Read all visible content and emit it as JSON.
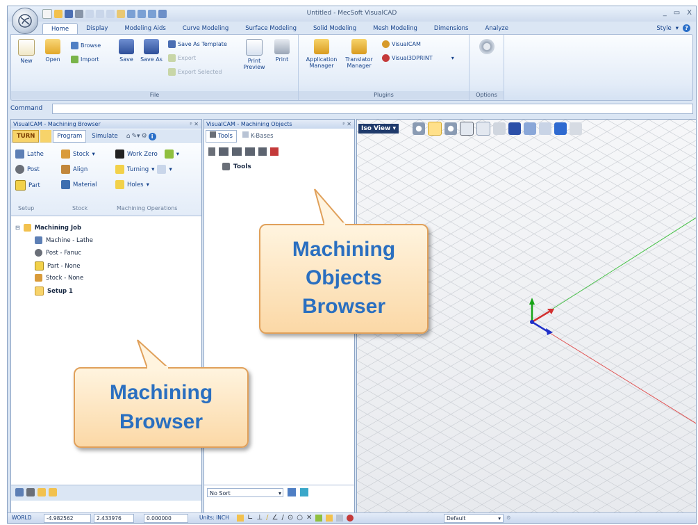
{
  "window": {
    "title": "Untitled - MecSoft VisualCAD",
    "min": "_",
    "max": "▭",
    "close": "X"
  },
  "ribbon_tabs": [
    "Home",
    "Display",
    "Modeling Aids",
    "Curve Modeling",
    "Surface Modeling",
    "Solid Modeling",
    "Mesh Modeling",
    "Dimensions",
    "Analyze"
  ],
  "style_menu": "Style",
  "ribbon": {
    "file": {
      "label": "File",
      "new": "New",
      "open": "Open",
      "browse": "Browse",
      "import": "Import",
      "save": "Save",
      "save_as": "Save As",
      "save_as_template": "Save As Template",
      "export": "Export",
      "export_selected": "Export Selected",
      "print_preview": "Print Preview",
      "print": "Print"
    },
    "plugins": {
      "label": "Plugins",
      "application_manager": "Application Manager",
      "translator_manager": "Translator Manager",
      "visualcam": "VisualCAM",
      "visual3dprint": "Visual3DPRINT"
    },
    "options": {
      "label": "Options"
    }
  },
  "command": {
    "label": "Command",
    "value": ""
  },
  "machining_browser": {
    "title": "VisualCAM - Machining Browser",
    "tabs": [
      "TURN",
      "Program",
      "Simulate"
    ],
    "setup": {
      "label": "Setup",
      "lathe": "Lathe",
      "post": "Post",
      "part": "Part"
    },
    "stock": {
      "label": "Stock",
      "stock": "Stock",
      "align": "Align",
      "material": "Material"
    },
    "ops": {
      "label": "Machining Operations",
      "work_zero": "Work Zero",
      "turning": "Turning",
      "holes": "Holes"
    },
    "tree": {
      "root": "Machining Job",
      "machine": "Machine - Lathe",
      "post": "Post - Fanuc",
      "part": "Part - None",
      "stock": "Stock - None",
      "setup": "Setup 1"
    }
  },
  "objects_browser": {
    "title": "VisualCAM - Machining Objects",
    "tabs": [
      "Tools",
      "K-Bases"
    ],
    "tree_root": "Tools",
    "sort": "No Sort"
  },
  "viewport": {
    "view": "Iso View"
  },
  "status": {
    "world": "WORLD",
    "x": "-4.982562",
    "y": "2.433976",
    "z": "0.000000",
    "units": "Units: INCH",
    "layer": "Default"
  },
  "callouts": {
    "objects": [
      "Machining",
      "Objects",
      "Browser"
    ],
    "browser": [
      "Machining",
      "Browser"
    ]
  }
}
